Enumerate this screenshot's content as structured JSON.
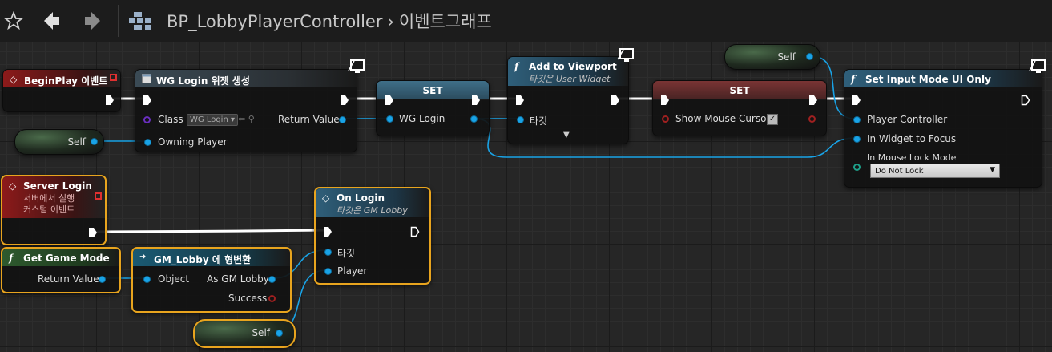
{
  "toolbar": {
    "breadcrumb_asset": "BP_LobbyPlayerController",
    "breadcrumb_graph": "이벤트그래프"
  },
  "nodes": {
    "begin_play": {
      "title": "BeginPlay 이벤트"
    },
    "create_widget": {
      "title": "WG Login 위젯 생성",
      "class_label": "Class",
      "class_value": "WG Login",
      "return_label": "Return Value",
      "owning_label": "Owning Player"
    },
    "set_wglogin": {
      "title": "SET",
      "pin_label": "WG Login"
    },
    "add_viewport": {
      "title": "Add to Viewport",
      "subtitle": "타깃은 User Widget",
      "target_label": "타깃"
    },
    "set_cursor": {
      "title": "SET",
      "pin_label": "Show Mouse Cursor",
      "checked": true
    },
    "set_input_mode": {
      "title": "Set Input Mode UI Only",
      "pc_label": "Player Controller",
      "focus_label": "In Widget to Focus",
      "lock_label": "In Mouse Lock Mode",
      "lock_value": "Do Not Lock"
    },
    "self_top": {
      "label": "Self"
    },
    "self_left": {
      "label": "Self"
    },
    "self_bottom": {
      "label": "Self"
    },
    "server_login": {
      "title": "Server Login",
      "subtitle_1": "서버에서 실행",
      "subtitle_2": "커스텀 이벤트"
    },
    "get_game_mode": {
      "title": "Get Game Mode",
      "return_label": "Return Value"
    },
    "cast": {
      "title": "GM_Lobby 에 형변환",
      "object_label": "Object",
      "as_label": "As GM Lobby",
      "success_label": "Success"
    },
    "on_login": {
      "title": "On Login",
      "subtitle": "타깃은 GM Lobby",
      "target_label": "타깃",
      "player_label": "Player"
    }
  },
  "colors": {
    "exec": "#ffffff",
    "object_pin": "#19a3e6",
    "selection": "#e8a41e"
  }
}
